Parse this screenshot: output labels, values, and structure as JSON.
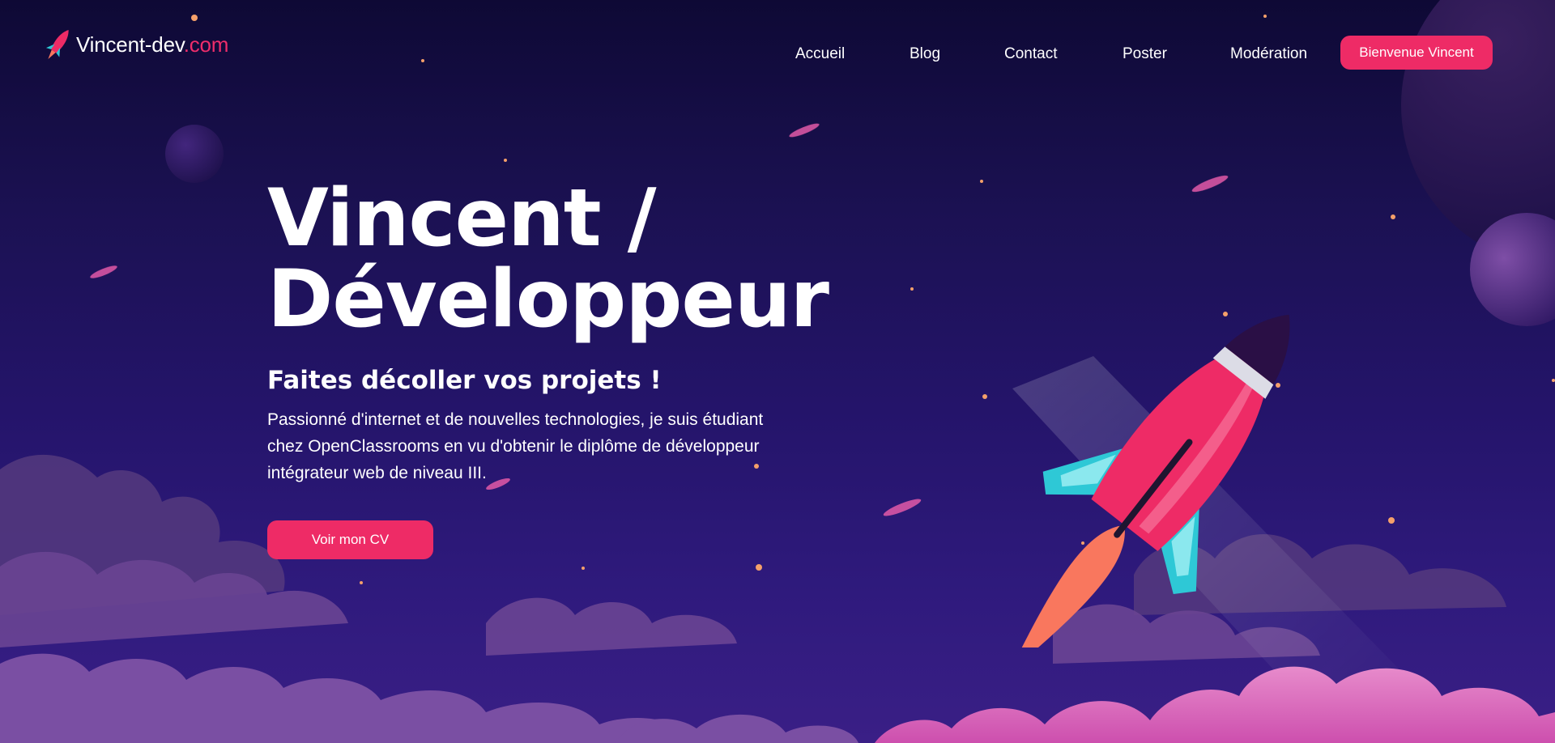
{
  "brand": {
    "name_main": "Vincent-dev",
    "name_accent": ".com",
    "accent_color": "#ef2d6b",
    "icon": "rocket-icon"
  },
  "nav": {
    "items": [
      {
        "label": "Accueil"
      },
      {
        "label": "Blog"
      },
      {
        "label": "Contact"
      },
      {
        "label": "Poster"
      },
      {
        "label": "Modération"
      }
    ],
    "cta_label": "Bienvenue Vincent"
  },
  "hero": {
    "title_line1": "Vincent /",
    "title_line2": "Développeur",
    "subtitle": "Faites décoller vos projets !",
    "description": "Passionné d'internet et de nouvelles technologies, je suis étudiant chez OpenClassrooms en vu d'obtenir le diplôme de développeur intégrateur web de niveau III.",
    "cta_label": "Voir mon CV"
  },
  "colors": {
    "background_top": "#0e0935",
    "background_bottom": "#3a1f86",
    "button": "#ee2b66",
    "rocket_body": "#ee2b66",
    "rocket_fins": "#2ec8d6",
    "flame": "#f9775e",
    "clouds": "#e06ab9"
  }
}
